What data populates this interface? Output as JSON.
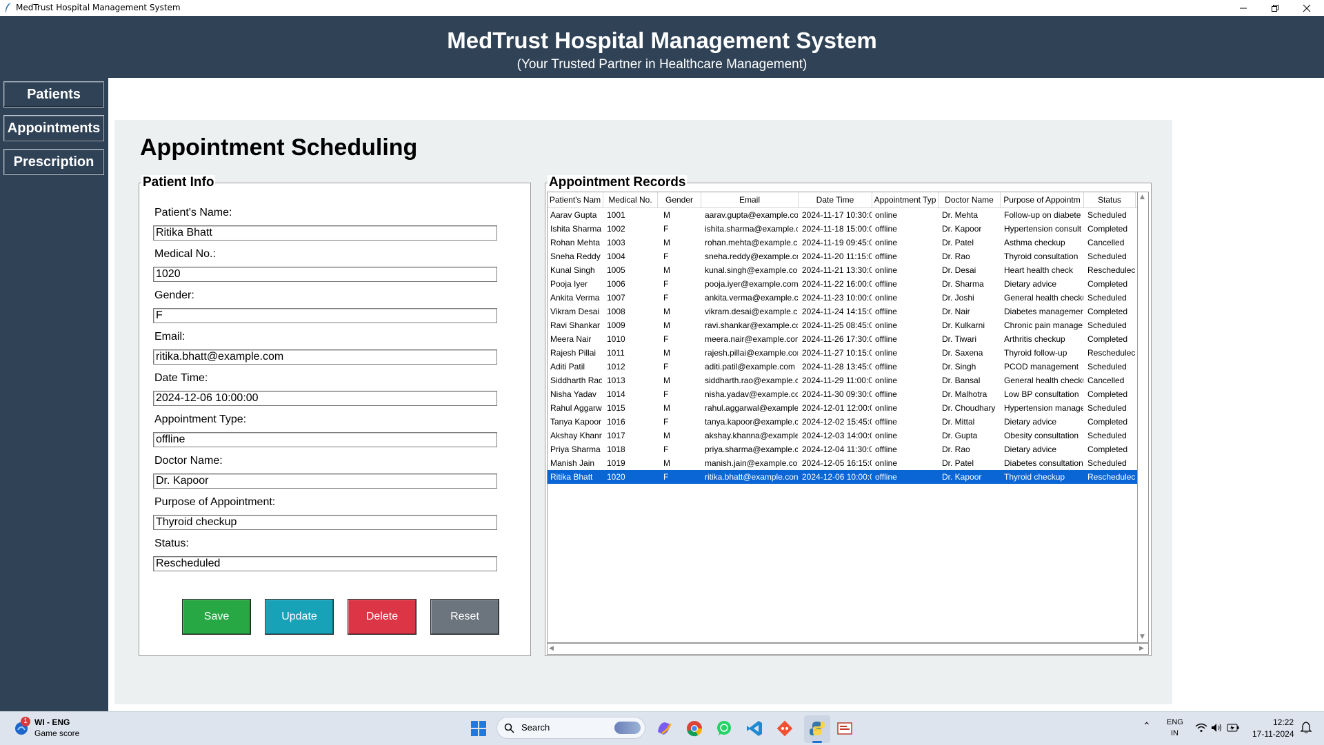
{
  "window": {
    "title": "MedTrust Hospital Management System"
  },
  "header": {
    "title": "MedTrust Hospital Management System",
    "subtitle": "(Your Trusted Partner in Healthcare Management)"
  },
  "sidebar": {
    "items": [
      {
        "label": "Patients"
      },
      {
        "label": "Appointments"
      },
      {
        "label": "Prescription"
      }
    ]
  },
  "page": {
    "heading": "Appointment Scheduling"
  },
  "patient_info": {
    "title": "Patient Info",
    "fields": [
      {
        "label": "Patient's Name:",
        "value": "Ritika Bhatt"
      },
      {
        "label": "Medical No.:",
        "value": "1020"
      },
      {
        "label": "Gender:",
        "value": "F"
      },
      {
        "label": "Email:",
        "value": "ritika.bhatt@example.com"
      },
      {
        "label": "Date Time:",
        "value": "2024-12-06 10:00:00"
      },
      {
        "label": "Appointment Type:",
        "value": "offline"
      },
      {
        "label": "Doctor Name:",
        "value": "Dr. Kapoor"
      },
      {
        "label": "Purpose of Appointment:",
        "value": "Thyroid checkup"
      },
      {
        "label": "Status:",
        "value": "Rescheduled"
      }
    ],
    "buttons": {
      "save": "Save",
      "update": "Update",
      "delete": "Delete",
      "reset": "Reset"
    },
    "colors": {
      "save": "#28a745",
      "update": "#17a2b8",
      "delete": "#dc3545",
      "reset": "#6c757d"
    }
  },
  "records": {
    "title": "Appointment Records",
    "columns": [
      "Patient's Nam",
      "Medical No.",
      "Gender",
      "Email",
      "Date Time",
      "Appointment Typ",
      "Doctor Name",
      "Purpose of Appointm",
      "Status"
    ],
    "selected_index": 19,
    "rows": [
      [
        "Aarav Gupta",
        "1001",
        "M",
        "aarav.gupta@example.co",
        "2024-11-17 10:30:0",
        "online",
        "Dr. Mehta",
        "Follow-up on diabete",
        "Scheduled"
      ],
      [
        "Ishita Sharma",
        "1002",
        "F",
        "ishita.sharma@example.c",
        "2024-11-18 15:00:0",
        "offline",
        "Dr. Kapoor",
        "Hypertension consult",
        "Completed"
      ],
      [
        "Rohan Mehta",
        "1003",
        "M",
        "rohan.mehta@example.c",
        "2024-11-19 09:45:0",
        "online",
        "Dr. Patel",
        "Asthma checkup",
        "Cancelled"
      ],
      [
        "Sneha Reddy",
        "1004",
        "F",
        "sneha.reddy@example.co",
        "2024-11-20 11:15:0",
        "offline",
        "Dr. Rao",
        "Thyroid consultation",
        "Scheduled"
      ],
      [
        "Kunal Singh",
        "1005",
        "M",
        "kunal.singh@example.co",
        "2024-11-21 13:30:0",
        "online",
        "Dr. Desai",
        "Heart health check",
        "Reschedulec"
      ],
      [
        "Pooja Iyer",
        "1006",
        "F",
        "pooja.iyer@example.com",
        "2024-11-22 16:00:0",
        "offline",
        "Dr. Sharma",
        "Dietary advice",
        "Completed"
      ],
      [
        "Ankita Verma",
        "1007",
        "F",
        "ankita.verma@example.c",
        "2024-11-23 10:00:0",
        "online",
        "Dr. Joshi",
        "General health checku",
        "Scheduled"
      ],
      [
        "Vikram Desai",
        "1008",
        "M",
        "vikram.desai@example.c",
        "2024-11-24 14:15:0",
        "offline",
        "Dr. Nair",
        "Diabetes managemen",
        "Completed"
      ],
      [
        "Ravi Shankar",
        "1009",
        "M",
        "ravi.shankar@example.co",
        "2024-11-25 08:45:0",
        "online",
        "Dr. Kulkarni",
        "Chronic pain manage",
        "Scheduled"
      ],
      [
        "Meera Nair",
        "1010",
        "F",
        "meera.nair@example.con",
        "2024-11-26 17:30:0",
        "offline",
        "Dr. Tiwari",
        "Arthritis checkup",
        "Completed"
      ],
      [
        "Rajesh Pillai",
        "1011",
        "M",
        "rajesh.pillai@example.cor",
        "2024-11-27 10:15:0",
        "online",
        "Dr. Saxena",
        "Thyroid follow-up",
        "Reschedulec"
      ],
      [
        "Aditi Patil",
        "1012",
        "F",
        "aditi.patil@example.com",
        "2024-11-28 13:45:0",
        "offline",
        "Dr. Singh",
        "PCOD management",
        "Scheduled"
      ],
      [
        "Siddharth Rao",
        "1013",
        "M",
        "siddharth.rao@example.c",
        "2024-11-29 11:00:0",
        "online",
        "Dr. Bansal",
        "General health checku",
        "Cancelled"
      ],
      [
        "Nisha Yadav",
        "1014",
        "F",
        "nisha.yadav@example.co",
        "2024-11-30 09:30:0",
        "offline",
        "Dr. Malhotra",
        "Low BP consultation",
        "Completed"
      ],
      [
        "Rahul Aggarw",
        "1015",
        "M",
        "rahul.aggarwal@example",
        "2024-12-01 12:00:0",
        "online",
        "Dr. Choudhary",
        "Hypertension manage",
        "Scheduled"
      ],
      [
        "Tanya Kapoor",
        "1016",
        "F",
        "tanya.kapoor@example.c",
        "2024-12-02 15:45:0",
        "offline",
        "Dr. Mittal",
        "Dietary advice",
        "Completed"
      ],
      [
        "Akshay Khann",
        "1017",
        "M",
        "akshay.khanna@example",
        "2024-12-03 14:00:0",
        "online",
        "Dr. Gupta",
        "Obesity consultation",
        "Scheduled"
      ],
      [
        "Priya Sharma",
        "1018",
        "F",
        "priya.sharma@example.c",
        "2024-12-04 11:30:0",
        "offline",
        "Dr. Rao",
        "Dietary advice",
        "Completed"
      ],
      [
        "Manish Jain",
        "1019",
        "M",
        "manish.jain@example.co",
        "2024-12-05 16:15:0",
        "online",
        "Dr. Patel",
        "Diabetes consultation",
        "Scheduled"
      ],
      [
        "Ritika Bhatt",
        "1020",
        "F",
        "ritika.bhatt@example.con",
        "2024-12-06 10:00:0",
        "offline",
        "Dr. Kapoor",
        "Thyroid checkup",
        "Reschedulec"
      ]
    ]
  },
  "taskbar": {
    "weather_title": "WI - ENG",
    "weather_sub": "Game score",
    "badge": "1",
    "search_placeholder": "Search",
    "lang_top": "ENG",
    "lang_bottom": "IN",
    "time": "12:22",
    "date": "17-11-2024"
  }
}
